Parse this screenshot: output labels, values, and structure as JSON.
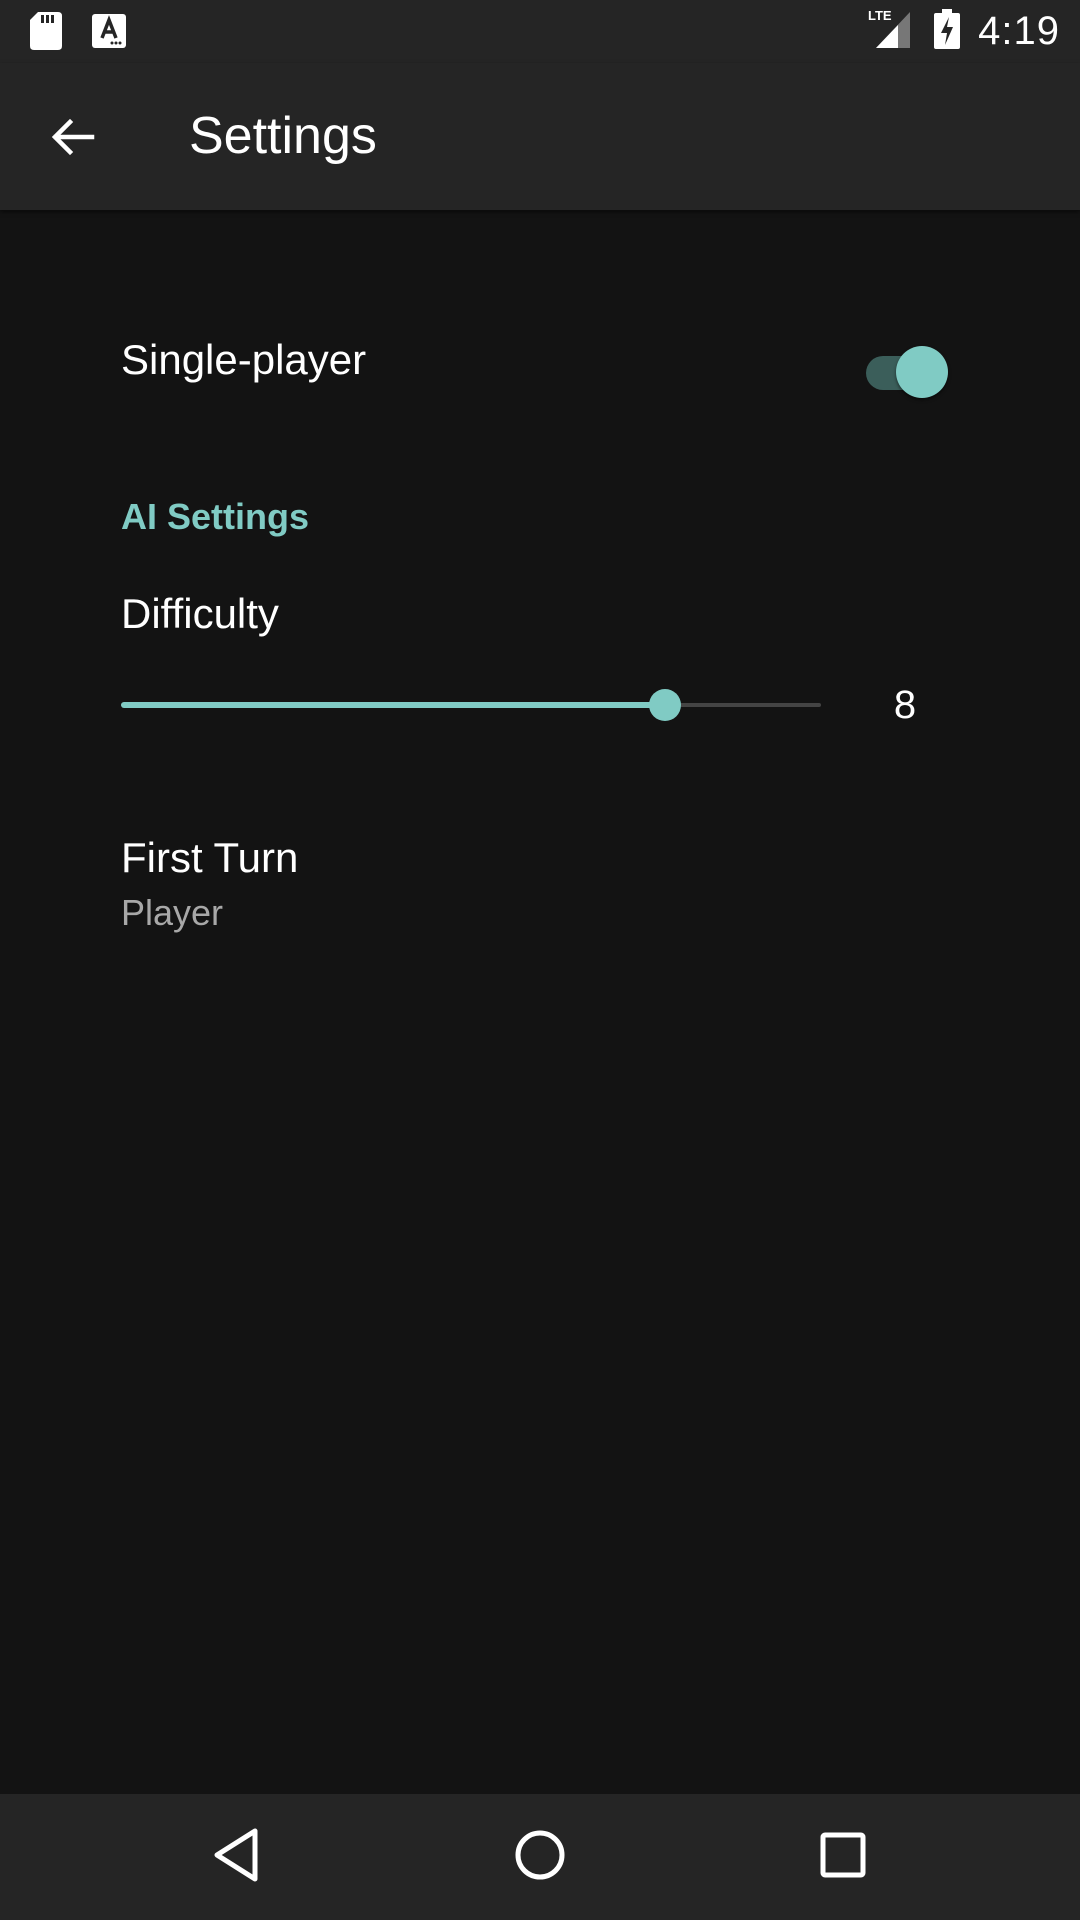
{
  "status_bar": {
    "time": "4:19",
    "icons": [
      "sd-card-icon",
      "font-download-icon",
      "lte-signal-icon",
      "battery-charging-icon"
    ]
  },
  "app_bar": {
    "title": "Settings",
    "back_icon": "arrow-back-icon"
  },
  "preferences": {
    "single_player": {
      "title": "Single-player",
      "enabled": true
    },
    "ai_category": {
      "title": "AI Settings"
    },
    "difficulty": {
      "title": "Difficulty",
      "value": "8",
      "fraction": 0.777
    },
    "first_turn": {
      "title": "First Turn",
      "summary": "Player"
    }
  },
  "nav_bar": {
    "buttons": [
      "back-triangle-icon",
      "home-circle-icon",
      "recents-square-icon"
    ]
  },
  "colors": {
    "accent": "#80cbc4",
    "background": "#131313",
    "bar": "#252525",
    "secondary_text": "#a8a8a8"
  }
}
